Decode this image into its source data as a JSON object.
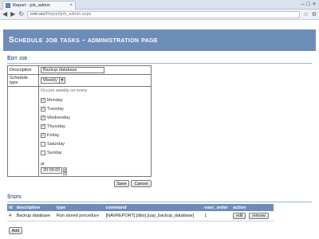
{
  "browser": {
    "tab_title": "Report - job_admin",
    "tab_close": "×",
    "url_host": "crm-srv",
    "url_path": "/Report/job_admin.aspx",
    "minimize": "–",
    "maximize": "□",
    "close": "×"
  },
  "page": {
    "title": "Schedule job tasks - administration page"
  },
  "edit_job": {
    "section_title": "Edit job",
    "description_label": "Description",
    "description_value": "Backup database",
    "schedule_type_label": "Schedule type",
    "schedule_type_value": "Weekly",
    "occurs_text": "Occurs weekly on every",
    "days": [
      {
        "name": "Monday",
        "checked": true
      },
      {
        "name": "Tuesday",
        "checked": true
      },
      {
        "name": "Wednesday",
        "checked": true
      },
      {
        "name": "Thursday",
        "checked": true
      },
      {
        "name": "Friday",
        "checked": true
      },
      {
        "name": "Saturday",
        "checked": false
      },
      {
        "name": "Sunday",
        "checked": false
      }
    ],
    "at_label": "at",
    "time_value": "20:00:00",
    "save_label": "Save",
    "cancel_label": "Cancel"
  },
  "steps": {
    "section_title": "Steps",
    "columns": [
      "id",
      "description",
      "type",
      "command",
      "exec_order",
      "action"
    ],
    "rows": [
      {
        "id": "4",
        "description": "Backup database",
        "type": "Run stored procedure",
        "command": "[NAVREPORT].[dbo].[usp_backup_database]",
        "exec_order": "1",
        "edit_label": "edit",
        "remove_label": "remove"
      }
    ],
    "add_label": "Add"
  },
  "colors": {
    "header_bg": "#6d8db9",
    "section_title": "#3b5e8c"
  }
}
